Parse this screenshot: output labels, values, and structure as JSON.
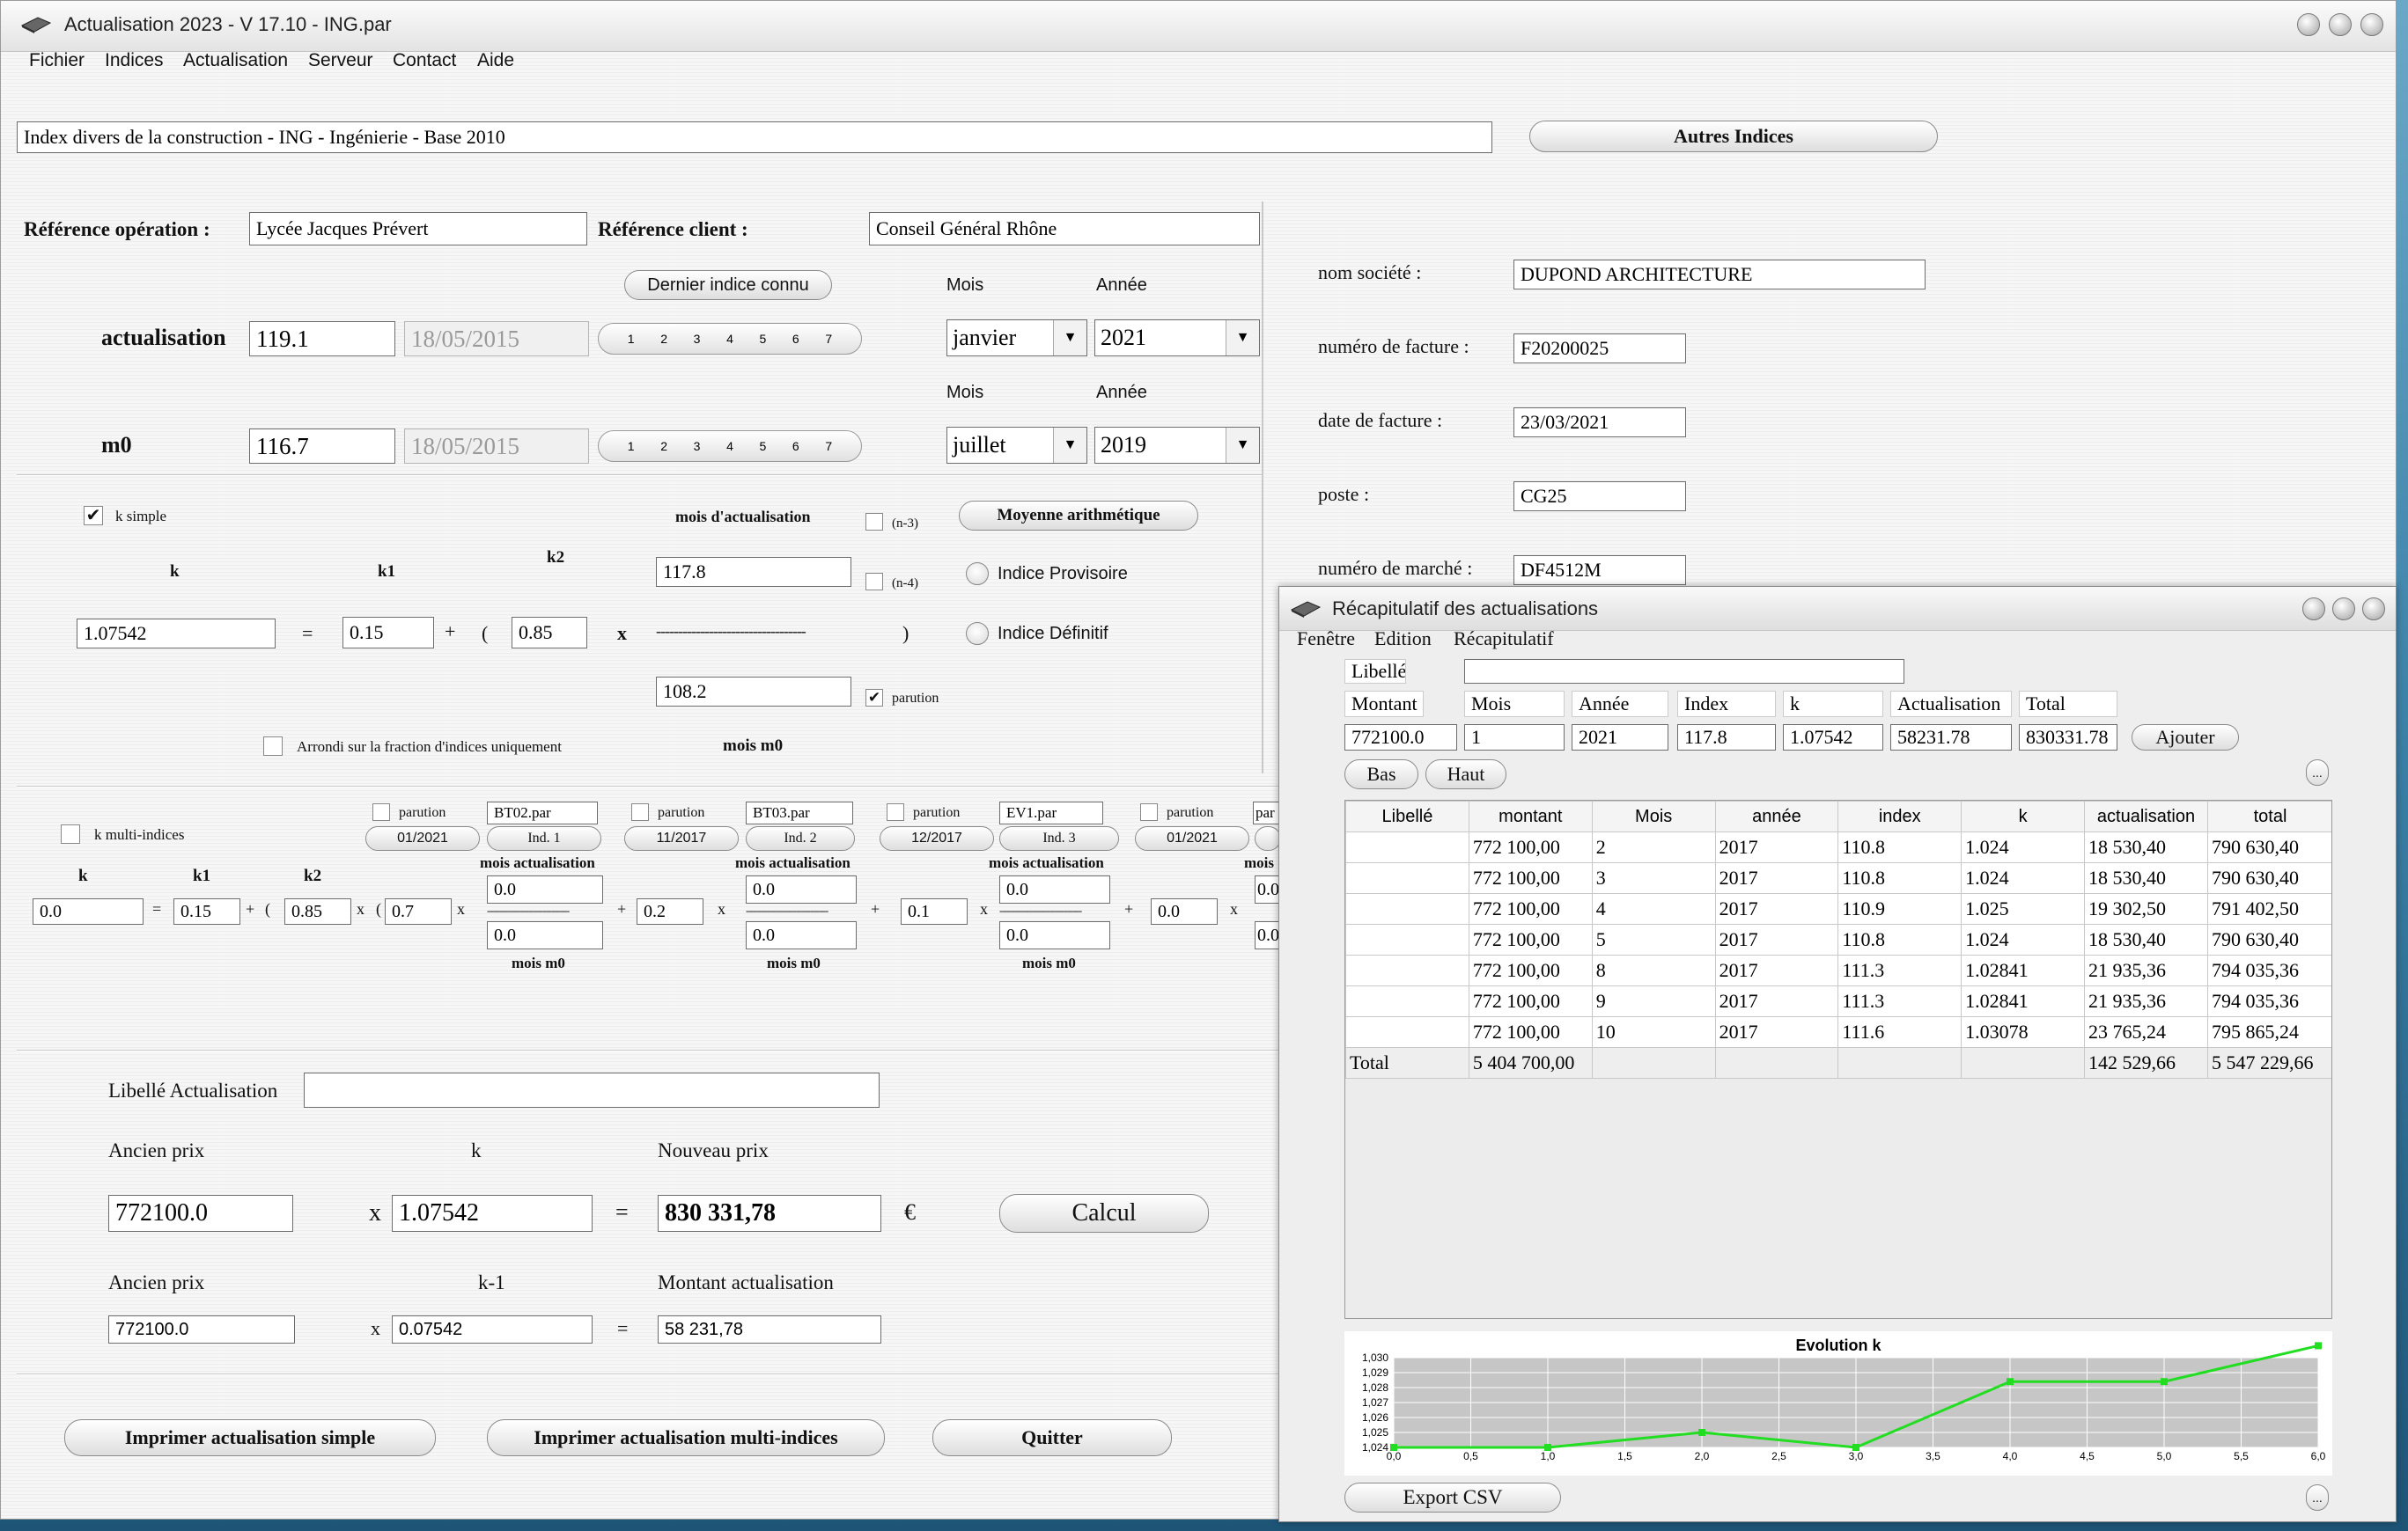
{
  "window": {
    "title": "Actualisation 2023 - V 17.10 - ING.par"
  },
  "menu": [
    "Fichier",
    "Indices",
    "Actualisation",
    "Serveur",
    "Contact",
    "Aide"
  ],
  "index_title": "Index divers de la construction - ING - Ingénierie - Base 2010",
  "autres_indices": "Autres Indices",
  "ref_op_label": "Référence opération :",
  "ref_op_value": "Lycée Jacques Prévert",
  "ref_client_label": "Référence client :",
  "ref_client_value": "Conseil Général Rhône",
  "dernier_indice": "Dernier indice connu",
  "mois_label": "Mois",
  "annee_label": "Année",
  "segments": [
    "1",
    "2",
    "3",
    "4",
    "5",
    "6",
    "7"
  ],
  "actualisation": {
    "label": "actualisation",
    "value": "119.1",
    "date": "18/05/2015",
    "mois": "janvier",
    "annee": "2021"
  },
  "m0": {
    "label": "m0",
    "value": "116.7",
    "date": "18/05/2015",
    "mois": "juillet",
    "annee": "2019"
  },
  "company": {
    "nom_label": "nom société :",
    "nom": "DUPOND ARCHITECTURE",
    "facture_label": "numéro de facture :",
    "facture": "F20200025",
    "date_label": "date de facture :",
    "date": "23/03/2021",
    "poste_label": "poste :",
    "poste": "CG25",
    "marche_label": "numéro de marché :",
    "marche": "DF4512M"
  },
  "ksimple": {
    "label": "k simple",
    "k_label": "k",
    "k1_label": "k1",
    "k2_label": "k2",
    "k": "1.07542",
    "k1": "0.15",
    "k2": "0.85",
    "eq": "=",
    "plus": "+",
    "paren_open": "(",
    "times": "x",
    "paren_close": ")",
    "mois_act_label": "mois d'actualisation",
    "mois_act": "117.8",
    "mois_m0": "108.2",
    "mois_m0_label": "mois m0",
    "dashes": "----------------------------------",
    "n3": "(n-3)",
    "n4": "(n-4)",
    "parution": "parution",
    "moyenne": "Moyenne arithmétique",
    "provisoire": "Indice Provisoire",
    "definitif": "Indice Définitif",
    "arrondi": "Arrondi sur la fraction d'indices uniquement"
  },
  "multi": {
    "label": "k multi-indices",
    "k_label": "k",
    "k1_label": "k1",
    "k2_label": "k2",
    "k": "0.0",
    "k1": "0.15",
    "k2": "0.85",
    "c1": "0.7",
    "c2": "0.2",
    "c3": "0.1",
    "c4": "0.0",
    "paren_open": "(",
    "parution": "parution",
    "mois_act": "mois actualisation",
    "mois_m0": "mois m0",
    "dashes": "----------------------------",
    "zero": "0.0",
    "mois_cut": "mois",
    "indices": [
      {
        "file": "BT02.par",
        "date": "01/2021",
        "ind": "Ind. 1"
      },
      {
        "file": "BT03.par",
        "date": "11/2017",
        "ind": "Ind. 2"
      },
      {
        "file": "EV1.par",
        "date": "12/2017",
        "ind": "Ind. 3"
      },
      {
        "file": "par",
        "date": "01/2021",
        "ind": ""
      }
    ]
  },
  "calc": {
    "libelle_label": "Libellé Actualisation",
    "libelle": "",
    "ancien_label": "Ancien prix",
    "k_label": "k",
    "nouveau_label": "Nouveau prix",
    "ancien": "772100.0",
    "k": "1.07542",
    "nouveau": "830 331,78",
    "euro": "€",
    "calcul": "Calcul",
    "ancien2_label": "Ancien prix",
    "k1_label": "k-1",
    "montant_label": "Montant actualisation",
    "ancien2": "772100.0",
    "k1": "0.07542",
    "montant": "58 231,78",
    "times": "x",
    "eq": "="
  },
  "buttons": {
    "print_simple": "Imprimer actualisation simple",
    "print_multi": "Imprimer actualisation multi-indices",
    "quit": "Quitter"
  },
  "recap": {
    "title": "Récapitulatif des actualisations",
    "menu": [
      "Fenêtre",
      "Edition",
      "Récapitulatif"
    ],
    "libelle_label": "Libellé",
    "libelle": "",
    "headers": [
      "Montant",
      "Mois",
      "Année",
      "Index",
      "k",
      "Actualisation",
      "Total"
    ],
    "entry": [
      "772100.0",
      "1",
      "2021",
      "117.8",
      "1.07542",
      "58231.78",
      "830331.78"
    ],
    "ajouter": "Ajouter",
    "bas": "Bas",
    "haut": "Haut",
    "ellipsis": "...",
    "columns": [
      "Libellé",
      "montant",
      "Mois",
      "année",
      "index",
      "k",
      "actualisation",
      "total"
    ],
    "rows": [
      [
        "",
        "772 100,00",
        "2",
        "2017",
        "110.8",
        "1.024",
        "18 530,40",
        "790 630,40"
      ],
      [
        "",
        "772 100,00",
        "3",
        "2017",
        "110.8",
        "1.024",
        "18 530,40",
        "790 630,40"
      ],
      [
        "",
        "772 100,00",
        "4",
        "2017",
        "110.9",
        "1.025",
        "19 302,50",
        "791 402,50"
      ],
      [
        "",
        "772 100,00",
        "5",
        "2017",
        "110.8",
        "1.024",
        "18 530,40",
        "790 630,40"
      ],
      [
        "",
        "772 100,00",
        "8",
        "2017",
        "111.3",
        "1.02841",
        "21 935,36",
        "794 035,36"
      ],
      [
        "",
        "772 100,00",
        "9",
        "2017",
        "111.3",
        "1.02841",
        "21 935,36",
        "794 035,36"
      ],
      [
        "",
        "772 100,00",
        "10",
        "2017",
        "111.6",
        "1.03078",
        "23 765,24",
        "795 865,24"
      ],
      [
        "Total",
        "5 404 700,00",
        "",
        "",
        "",
        "",
        "142 529,66",
        "5 547 229,66"
      ]
    ],
    "export": "Export CSV"
  },
  "chart_data": {
    "type": "line",
    "title": "Evolution k",
    "x": [
      0,
      1,
      2,
      3,
      4,
      5,
      6
    ],
    "y": [
      1.024,
      1.024,
      1.025,
      1.024,
      1.0284,
      1.0284,
      1.0308
    ],
    "xlim": [
      0,
      6
    ],
    "ylim": [
      1.024,
      1.03
    ],
    "xticks": [
      "0,0",
      "0,5",
      "1,0",
      "1,5",
      "2,0",
      "2,5",
      "3,0",
      "3,5",
      "4,0",
      "4,5",
      "5,0",
      "5,5",
      "6,0"
    ],
    "yticks": [
      "1,030",
      "1,029",
      "1,028",
      "1,027",
      "1,026",
      "1,025",
      "1,024"
    ],
    "color": "#22dd22",
    "grid": true
  }
}
